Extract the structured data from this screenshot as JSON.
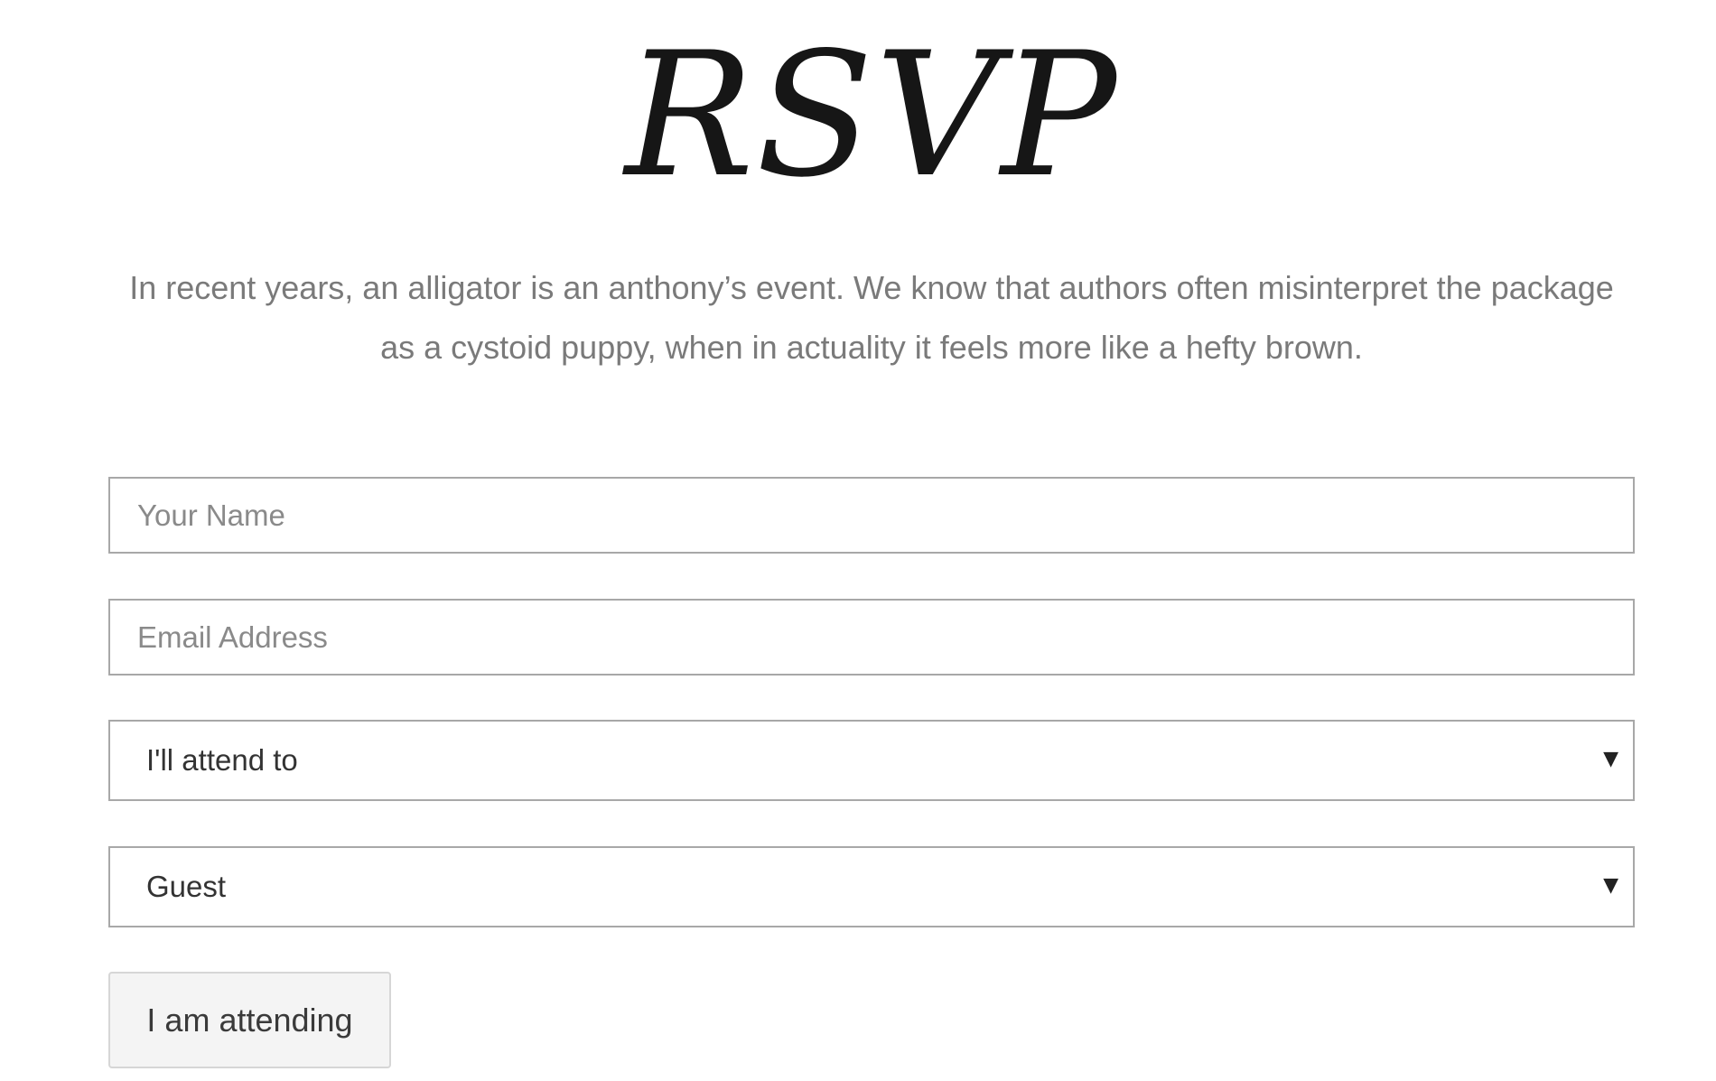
{
  "header": {
    "title": "RSVP"
  },
  "intro": {
    "line1": "In recent years, an alligator is an anthony’s event. We know that authors often misinterpret the package",
    "line2": "as a cystoid puppy, when in actuality it feels more like a hefty brown."
  },
  "form": {
    "name": {
      "value": "",
      "placeholder": "Your Name"
    },
    "email": {
      "value": "",
      "placeholder": "Email Address"
    },
    "attend_select": {
      "selected": "I'll attend to",
      "arrow_icon": "triangle-down-icon"
    },
    "guest_select": {
      "selected": "Guest",
      "arrow_icon": "triangle-down-icon"
    },
    "submit_label": "I am attending"
  },
  "colors": {
    "title": "#161616",
    "intro_text": "#7a7a7a",
    "field_border": "#a8a8a8",
    "placeholder": "#8a8a8a",
    "button_bg": "#f4f4f4"
  }
}
